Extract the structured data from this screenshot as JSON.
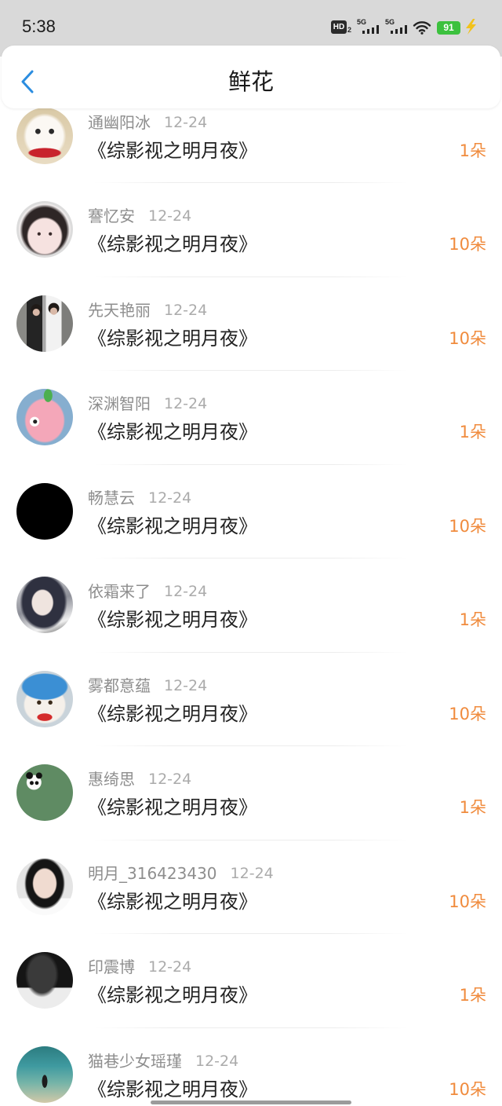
{
  "status_bar": {
    "time": "5:38",
    "hd_label": "HD",
    "hd_sub": "2",
    "network_1": "5G",
    "network_2": "5G",
    "battery": "91",
    "wifi_icon": "wifi-icon",
    "charging_icon": "charging-bolt-icon"
  },
  "header": {
    "back_icon": "chevron-left-icon",
    "title": "鲜花"
  },
  "colors": {
    "accent": "#2b8de0",
    "count": "#f08b3d",
    "battery": "#3cc13e"
  },
  "gifts": [
    {
      "user": "通幽阳冰",
      "date": "12-24",
      "book": "《综影视之明月夜》",
      "count": "1朵"
    },
    {
      "user": "謇忆安",
      "date": "12-24",
      "book": "《综影视之明月夜》",
      "count": "10朵"
    },
    {
      "user": "先天艳丽",
      "date": "12-24",
      "book": "《综影视之明月夜》",
      "count": "10朵"
    },
    {
      "user": "深渊智阳",
      "date": "12-24",
      "book": "《综影视之明月夜》",
      "count": "1朵"
    },
    {
      "user": "畅慧云",
      "date": "12-24",
      "book": "《综影视之明月夜》",
      "count": "10朵"
    },
    {
      "user": "依霜来了",
      "date": "12-24",
      "book": "《综影视之明月夜》",
      "count": "1朵"
    },
    {
      "user": "雾都意蕴",
      "date": "12-24",
      "book": "《综影视之明月夜》",
      "count": "10朵"
    },
    {
      "user": "惠绮思",
      "date": "12-24",
      "book": "《综影视之明月夜》",
      "count": "1朵"
    },
    {
      "user": "明月_316423430",
      "date": "12-24",
      "book": "《综影视之明月夜》",
      "count": "10朵"
    },
    {
      "user": "印震博",
      "date": "12-24",
      "book": "《综影视之明月夜》",
      "count": "1朵"
    },
    {
      "user": "猫巷少女瑶瑾",
      "date": "12-24",
      "book": "《综影视之明月夜》",
      "count": "10朵"
    }
  ]
}
